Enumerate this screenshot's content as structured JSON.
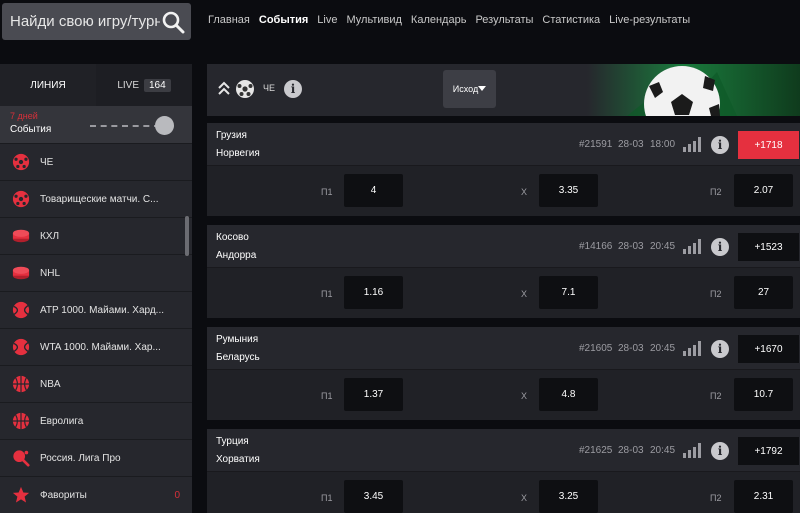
{
  "search": {
    "placeholder": "Найди свою игру/турнир"
  },
  "nav": [
    "Главная",
    "События",
    "Live",
    "Мультивид",
    "Календарь",
    "Результаты",
    "Статистика",
    "Live-результаты"
  ],
  "nav_active": "События",
  "sidebar": {
    "tab_line": "ЛИНИЯ",
    "tab_live": "LIVE",
    "live_count": "164",
    "days": "7 дней",
    "events": "События",
    "items": [
      {
        "label": "ЧЕ",
        "icon": "football-icon"
      },
      {
        "label": "Товарищеские матчи. С...",
        "icon": "football-icon"
      },
      {
        "label": "КХЛ",
        "icon": "hockey-puck-icon"
      },
      {
        "label": "NHL",
        "icon": "hockey-puck-icon"
      },
      {
        "label": "ATP 1000. Майами. Хард...",
        "icon": "tennis-ball-icon"
      },
      {
        "label": "WTA 1000. Майами. Хар...",
        "icon": "tennis-ball-icon"
      },
      {
        "label": "NBA",
        "icon": "basketball-icon"
      },
      {
        "label": "Евролига",
        "icon": "basketball-icon"
      },
      {
        "label": "Россия. Лига Про",
        "icon": "table-tennis-icon"
      },
      {
        "label": "Фавориты",
        "icon": "star-icon",
        "count": "0"
      }
    ]
  },
  "header": {
    "league": "ЧЕ",
    "outcome_label": "Исход"
  },
  "labels": {
    "p1": "П1",
    "x": "X",
    "p2": "П2"
  },
  "matches": [
    {
      "team1": "Грузия",
      "team2": "Норвегия",
      "id": "#21591",
      "date": "28-03",
      "time": "18:00",
      "markets": "+1718",
      "hot": true,
      "p1": "4",
      "x": "3.35",
      "p2": "2.07"
    },
    {
      "team1": "Косово",
      "team2": "Андорра",
      "id": "#14166",
      "date": "28-03",
      "time": "20:45",
      "markets": "+1523",
      "hot": false,
      "p1": "1.16",
      "x": "7.1",
      "p2": "27"
    },
    {
      "team1": "Румыния",
      "team2": "Беларусь",
      "id": "#21605",
      "date": "28-03",
      "time": "20:45",
      "markets": "+1670",
      "hot": false,
      "p1": "1.37",
      "x": "4.8",
      "p2": "10.7"
    },
    {
      "team1": "Турция",
      "team2": "Хорватия",
      "id": "#21625",
      "date": "28-03",
      "time": "20:45",
      "markets": "+1792",
      "hot": false,
      "p1": "3.45",
      "x": "3.25",
      "p2": "2.31"
    }
  ],
  "colors": {
    "accent": "#e5303f",
    "days_red": "#d6303a",
    "panel": "#26272d",
    "background": "#0b0c10"
  }
}
